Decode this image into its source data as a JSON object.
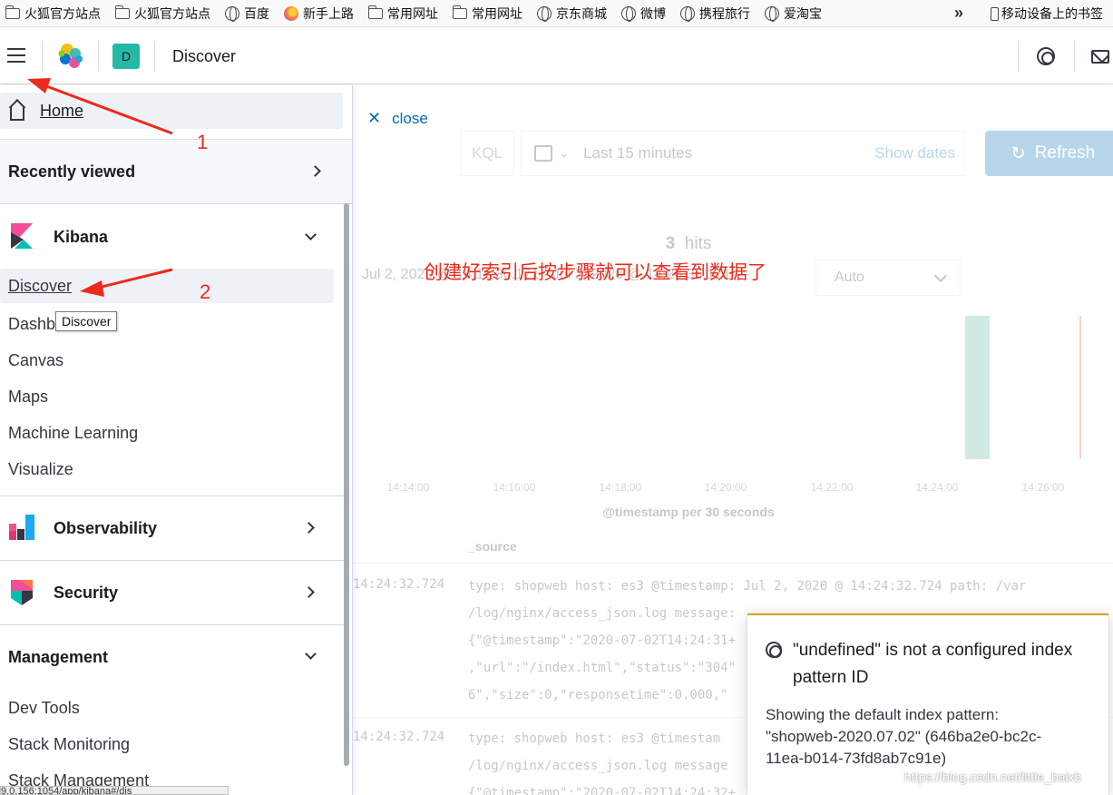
{
  "bookmarks": {
    "items": [
      {
        "label": "火狐官方站点",
        "icon": "folder-icon"
      },
      {
        "label": "火狐官方站点",
        "icon": "folder-icon"
      },
      {
        "label": "百度",
        "icon": "globe-icon"
      },
      {
        "label": "新手上路",
        "icon": "firefox-icon"
      },
      {
        "label": "常用网址",
        "icon": "folder-icon"
      },
      {
        "label": "常用网址",
        "icon": "folder-icon"
      },
      {
        "label": "京东商城",
        "icon": "globe-icon"
      },
      {
        "label": "微博",
        "icon": "globe-icon"
      },
      {
        "label": "携程旅行",
        "icon": "globe-icon"
      },
      {
        "label": "爱淘宝",
        "icon": "globe-icon"
      }
    ],
    "more": "»",
    "mobile": "移动设备上的书签"
  },
  "header": {
    "space_initial": "D",
    "space_color": "#26b8a6",
    "app_title": "Discover"
  },
  "sidenav": {
    "home": "Home",
    "recently_viewed": "Recently viewed",
    "kibana": {
      "title": "Kibana",
      "items": [
        "Discover",
        "Dashb",
        "Canvas",
        "Maps",
        "Machine Learning",
        "Visualize"
      ]
    },
    "tooltip": "Discover",
    "observability": "Observability",
    "security": "Security",
    "management": {
      "title": "Management",
      "items": [
        "Dev Tools",
        "Stack Monitoring",
        "Stack Management"
      ]
    }
  },
  "main": {
    "close": "close",
    "kql": "KQL",
    "time_range": "Last 15 minutes",
    "show_dates": "Show dates",
    "refresh": "Refresh",
    "hits_count": "3",
    "hits_label": "hits",
    "date_range": "Jul 2, 2020 @ 14:11:36.171 - Jul 2, 2020 @ 14:26:36.171 —",
    "interval": "Auto",
    "chart_ticks": [
      "14:14:00",
      "14:16:00",
      "14:18:00",
      "14:20:00",
      "14:22:00",
      "14:24:00",
      "14:26:00"
    ],
    "axis_title": "@timestamp per 30 seconds",
    "source_header": "_source",
    "rows": [
      {
        "time": "14:24:32.724",
        "lines": [
          "type: shopweb host: es3 @timestamp: Jul 2, 2020 @ 14:24:32.724 path: /var",
          "/log/nginx/access_json.log message:",
          "{\"@timestamp\":\"2020-07-02T14:24:31+",
          ",\"url\":\"/index.html\",\"status\":\"304\"",
          "6\",\"size\":0,\"responsetime\":0.000,\""
        ]
      },
      {
        "time": "14:24:32.724",
        "lines": [
          "type: shopweb host: es3 @timestam",
          "/log/nginx/access_json.log message",
          "{\"@timestamp\":\"2020-07-02T14:24:32+"
        ]
      }
    ]
  },
  "annotation": {
    "text": "创建好索引后按步骤就可以查看到数据了",
    "num1": "1",
    "num2": "2",
    "color": "#ee2a1a"
  },
  "toast": {
    "title": "\"undefined\" is not a configured index pattern ID",
    "body": "Showing the default index pattern: \"shopweb-2020.07.02\" (646ba2e0-bc2c-11ea-b014-73fd8ab7c91e)",
    "border_color": "#d3a80b"
  },
  "watermark": "https://blog.csdn.net/little_baixb",
  "status_url": "9.0.156:1054/app/kibana#/dis"
}
